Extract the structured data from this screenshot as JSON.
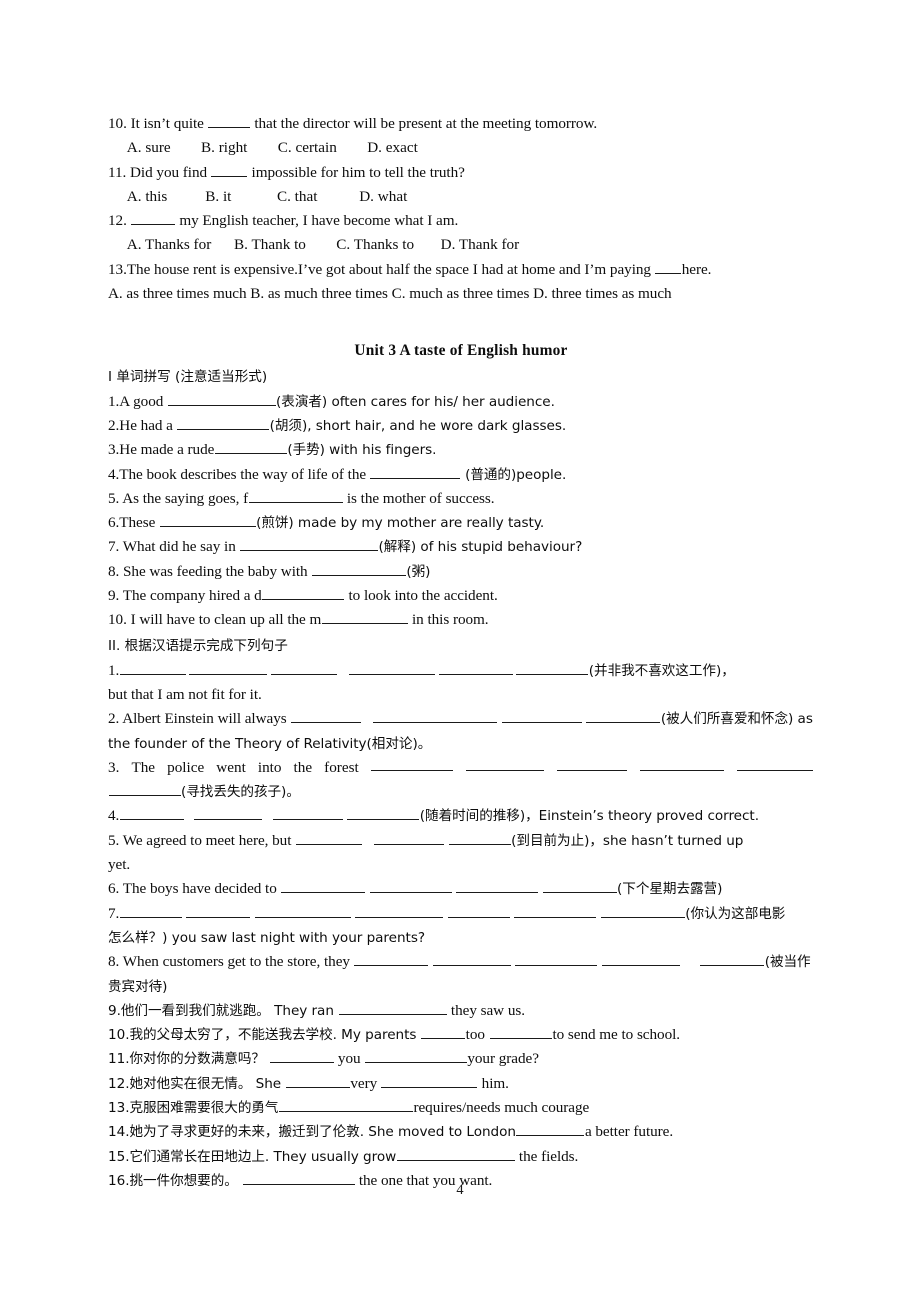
{
  "document": {
    "page_number": "4",
    "ink_color": "#0d0d0d"
  },
  "mcq_section": {
    "questions": [
      {
        "stem_before": "10. It isn’t quite ",
        "blank_width": 42,
        "stem_after": " that the director will be present at the meeting tomorrow.",
        "options_line": "  A. sure        B. right        C. certain        D. exact"
      },
      {
        "stem_before": "11. Did you find ",
        "blank_width": 36,
        "stem_after": " impossible for him to tell the truth?",
        "options_line": "  A. this          B. it            C. that           D. what"
      },
      {
        "stem_before": "12.  ",
        "blank_width": 44,
        "stem_after": " my English teacher, I have become what I am.",
        "options_line": "  A. Thanks for      B. Thank to        C. Thanks to       D. Thank for"
      }
    ],
    "q13": {
      "stem_before": "13.The house rent is expensive.I’ve got about half the space I had at home and I’m paying ",
      "blank_width": 26,
      "stem_after": "here.",
      "options_line": "A. as three times much   B. as much three times  C. much as three times   D. three times as much"
    }
  },
  "unit": {
    "heading": "Unit 3    A taste of English humor"
  },
  "section_one": {
    "heading": "Ⅰ 单词拼写 (注意适当形式)",
    "items": [
      {
        "before": "1.A good ",
        "blank_width": 108,
        "after": "(表演者) often cares for his/ her audience."
      },
      {
        "before": "2.He had a ",
        "blank_width": 92,
        "after": "(胡须), short hair, and he wore dark glasses."
      },
      {
        "before": "3.He made a rude",
        "blank_width": 72,
        "after": "(手势) with his fingers."
      },
      {
        "before": "4.The book describes the way of life of the ",
        "blank_width": 90,
        "after": " (普通的)people."
      },
      {
        "before": "5. As the saying goes, f",
        "blank_width": 94,
        "after": " is the mother of success."
      },
      {
        "before": "6.These ",
        "blank_width": 96,
        "after": "(煎饼) made by my mother are really tasty."
      },
      {
        "before": "7. What did he say in ",
        "blank_width": 138,
        "after": "(解释) of his stupid behaviour?"
      },
      {
        "before": "8. She was feeding the baby with ",
        "blank_width": 94,
        "after": "(粥)"
      },
      {
        "before": "9. The company hired a d",
        "blank_width": 82,
        "after": " to look into the accident."
      },
      {
        "before": "10. I will have to clean up all the m",
        "blank_width": 86,
        "after": " in this room."
      }
    ]
  },
  "section_two": {
    "heading": "II.  根据汉语提示完成下列句子",
    "items": [
      {
        "id": "s2-1",
        "lead": "1.",
        "blanks": [
          66,
          78,
          66,
          86,
          74,
          72
        ],
        "blank_gaps": [
          3,
          3,
          12,
          3,
          3
        ],
        "tail": "(并非我不喜欢这工作)，",
        "continuation": "but that I am not fit for it."
      },
      {
        "id": "s2-2",
        "lead": "2. Albert Einstein will always ",
        "blanks": [
          70,
          124,
          80,
          74
        ],
        "blank_gaps": [
          12,
          4,
          4
        ],
        "tail": "(被人们所喜爱和怀念) as",
        "continuation": "the founder of the Theory of Relativity(相对论)。"
      },
      {
        "id": "s2-3",
        "lead_words": [
          "3.",
          "The",
          "police",
          "went",
          "into",
          "the",
          "forest"
        ],
        "blanks": [
          82,
          78,
          70,
          84,
          76
        ],
        "second_line_blank": 72,
        "tail": "(寻找丢失的孩子)。"
      },
      {
        "id": "s2-4",
        "lead": "4.",
        "blanks": [
          64,
          68,
          70,
          72
        ],
        "blank_gaps": [
          10,
          10,
          4
        ],
        "tail": "(随着时间的推移)，Einstein’s theory proved correct."
      },
      {
        "id": "s2-5",
        "lead": "5. We agreed to meet here, but ",
        "blanks": [
          66,
          70,
          62
        ],
        "blank_gaps": [
          12,
          4
        ],
        "tail": "(到目前为止)，she hasn’t turned up",
        "continuation": "yet."
      },
      {
        "id": "s2-6",
        "lead": "6. The boys have decided to ",
        "blanks": [
          84,
          82,
          82,
          74
        ],
        "blank_gaps": [
          4,
          4,
          4
        ],
        "tail": "(下个星期去露营)"
      },
      {
        "id": "s2-7",
        "lead": "7.",
        "blanks": [
          62,
          64,
          96,
          88,
          62,
          82,
          84
        ],
        "blank_gaps": [
          4,
          4,
          4,
          4,
          4,
          4
        ],
        "tail": "(你认为这部电影",
        "continuation": "怎么样？) you saw last night with your parents?"
      },
      {
        "id": "s2-8",
        "lead": "8. When customers get to the store, they ",
        "blanks": [
          74,
          78,
          82,
          78,
          64
        ],
        "blank_gaps": [
          4,
          4,
          4,
          20
        ],
        "tail": "(被当作",
        "continuation": "贵宾对待)"
      },
      {
        "id": "s2-9",
        "lead": "9.他们一看到我们就逃跑。  They ran ",
        "blanks": [
          108
        ],
        "blank_gaps": [],
        "tail": " they saw us."
      },
      {
        "id": "s2-10",
        "lead": "10.我的父母太穷了，不能送我去学校. My parents ",
        "blanks": [
          44
        ],
        "mid": "too",
        "blanks2": [
          62
        ],
        "tail": "to send me to school."
      },
      {
        "id": "s2-11",
        "lead": "11.你对你的分数满意吗？   ",
        "blanks": [
          64
        ],
        "mid": " you ",
        "blanks2": [
          102
        ],
        "tail": "your grade?"
      },
      {
        "id": "s2-12",
        "lead": "12.她对他实在很无情。  She ",
        "blanks": [
          64
        ],
        "mid": "very ",
        "blanks2": [
          96
        ],
        "tail": " him."
      },
      {
        "id": "s2-13",
        "lead": "13.克服困难需要很大的勇气",
        "blanks": [
          134
        ],
        "tail": "requires/needs much courage"
      },
      {
        "id": "s2-14",
        "lead": "14.她为了寻求更好的未来，搬迁到了伦敦. She moved to London",
        "blanks": [
          68
        ],
        "tail": "a better future."
      },
      {
        "id": "s2-15",
        "lead": "15.它们通常长在田地边上. They usually grow",
        "blanks": [
          118
        ],
        "tail": " the fields."
      },
      {
        "id": "s2-16",
        "lead": "16.挑一件你想要的。   ",
        "blanks": [
          112
        ],
        "tail": " the one that you want."
      }
    ]
  }
}
